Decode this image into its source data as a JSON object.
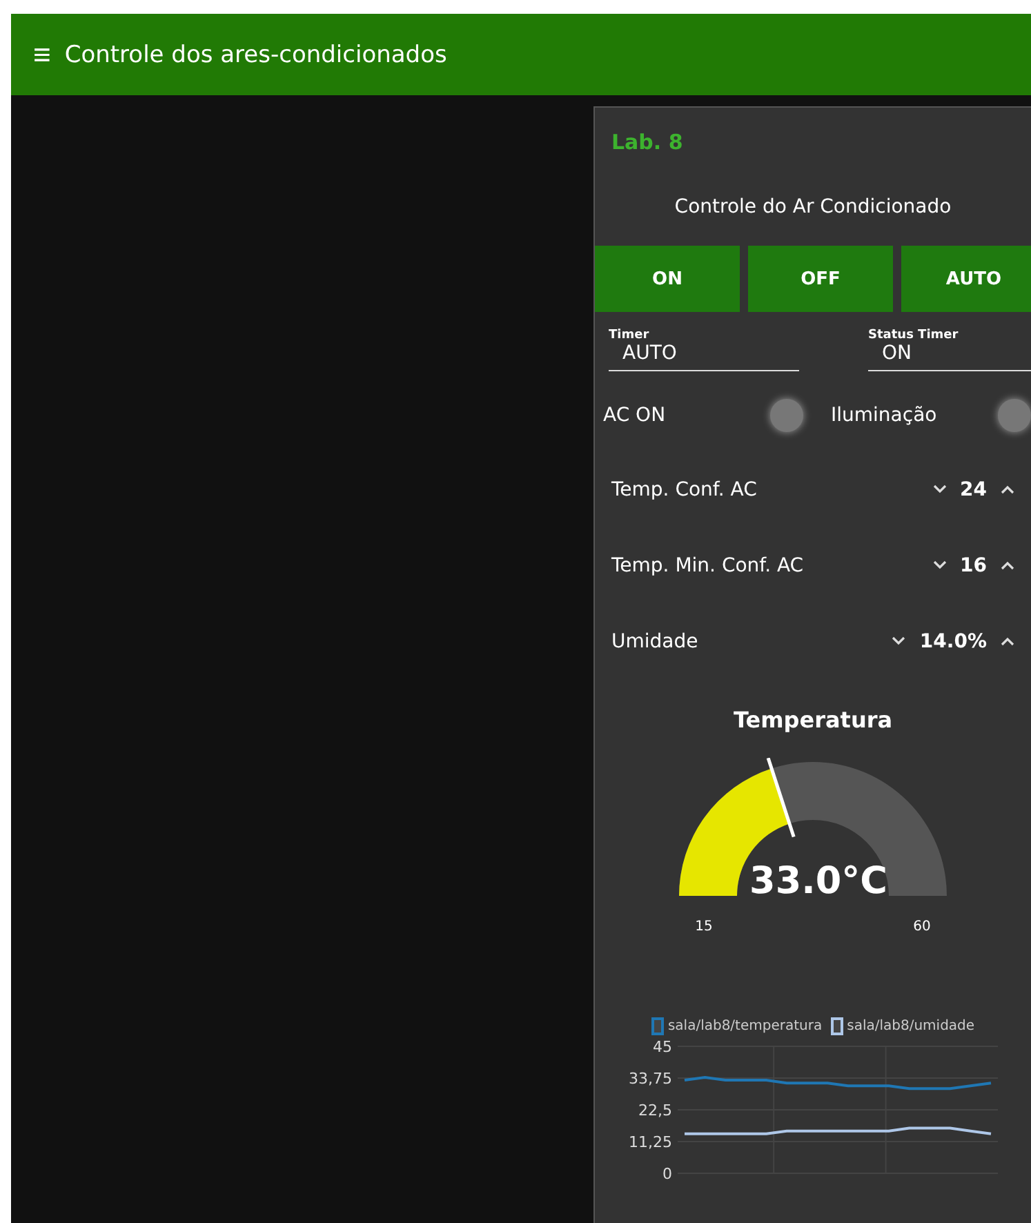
{
  "header": {
    "menu_icon": "≡",
    "title": "Controle dos ares-condicionados"
  },
  "panel": {
    "group_title": "Lab. 8",
    "subtitle": "Controle do Ar Condicionado",
    "buttons": [
      "ON",
      "OFF",
      "AUTO"
    ],
    "fields": [
      {
        "label": "Timer",
        "value": "AUTO"
      },
      {
        "label": "Status Timer",
        "value": "ON"
      }
    ],
    "indicators": [
      {
        "label": "AC ON",
        "on": false
      },
      {
        "label": "Iluminação",
        "on": false
      }
    ],
    "numerics": [
      {
        "label": "Temp. Conf. AC",
        "value": "24"
      },
      {
        "label": "Temp. Min. Conf. AC",
        "value": "16"
      },
      {
        "label": "Umidade",
        "value": "14.0%"
      }
    ],
    "gauge": {
      "title": "Temperatura",
      "value": "33.0°C",
      "min": "15",
      "max": "60",
      "level": 0.4
    },
    "chart_data": {
      "type": "line",
      "yticks": [
        {
          "value": 0,
          "label": "0"
        },
        {
          "value": 11.25,
          "label": "11,25"
        },
        {
          "value": 22.5,
          "label": "22,5"
        },
        {
          "value": 33.75,
          "label": "33,75"
        },
        {
          "value": 45,
          "label": "45"
        }
      ],
      "ylim": [
        0,
        45
      ],
      "grid": true,
      "legend": "top",
      "series": [
        {
          "name": "sala/lab8/temperatura",
          "color": "#1f77b4",
          "values": [
            33,
            34,
            33,
            33,
            33,
            32,
            32,
            32,
            31,
            31,
            31,
            30,
            30,
            30,
            31,
            32
          ]
        },
        {
          "name": "sala/lab8/umidade",
          "color": "#aec7e8",
          "values": [
            14,
            14,
            14,
            14,
            14,
            15,
            15,
            15,
            15,
            15,
            15,
            16,
            16,
            16,
            15,
            14
          ]
        }
      ]
    }
  }
}
